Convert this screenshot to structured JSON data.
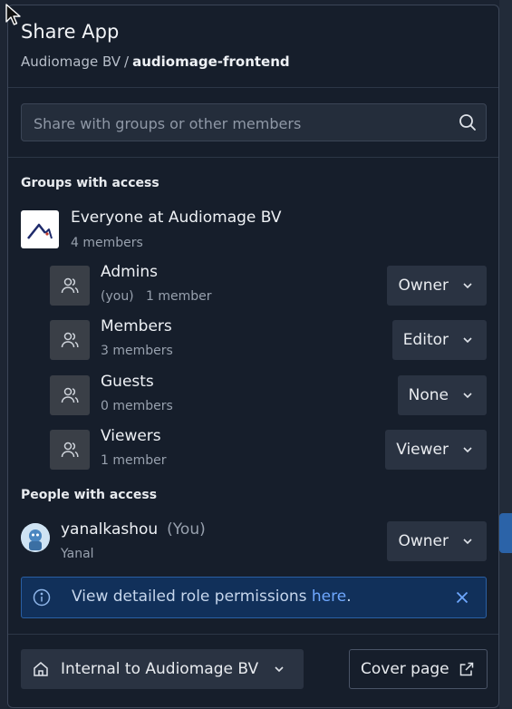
{
  "modal": {
    "title": "Share App",
    "breadcrumb": {
      "org": "Audiomage BV",
      "separator": "/",
      "app": "audiomage-frontend"
    }
  },
  "search": {
    "placeholder": "Share with groups or other members",
    "icon": "search-icon"
  },
  "groups_section": {
    "label": "Groups with access",
    "org": {
      "name": "Everyone at Audiomage BV",
      "members": "4 members"
    },
    "groups": [
      {
        "name": "Admins",
        "you": "(you)",
        "members": "1 member",
        "role": "Owner"
      },
      {
        "name": "Members",
        "you": "",
        "members": "3 members",
        "role": "Editor"
      },
      {
        "name": "Guests",
        "you": "",
        "members": "0 members",
        "role": "None"
      },
      {
        "name": "Viewers",
        "you": "",
        "members": "1 member",
        "role": "Viewer"
      }
    ]
  },
  "people_section": {
    "label": "People with access",
    "people": [
      {
        "username": "yanalkashou",
        "you": "(You)",
        "display_name": "Yanal",
        "role": "Owner"
      }
    ]
  },
  "info_banner": {
    "text": "View detailed role permissions ",
    "link": "here",
    "suffix": "."
  },
  "footer": {
    "visibility": "Internal to Audiomage BV",
    "cover_page": "Cover page"
  },
  "colors": {
    "accent": "#2a5fa3",
    "link": "#6fa8ff",
    "modal_bg": "#161e2b"
  }
}
